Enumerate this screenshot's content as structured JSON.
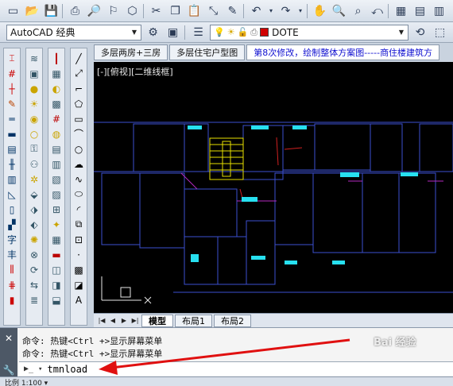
{
  "toolbar1": {
    "icons": [
      "new-file-icon",
      "open-folder-icon",
      "save-icon",
      "print-icon",
      "preview-icon",
      "publish-icon",
      "3d-icon",
      "cut-icon",
      "copy-icon",
      "paste-icon",
      "match-icon",
      "brush-icon",
      "undo-icon",
      "redo-icon",
      "pan-icon",
      "zoom-icon",
      "zoom-window-icon",
      "zoom-previous-icon",
      "properties-icon",
      "design-center-icon",
      "tool-palette-icon",
      "sheet-icon",
      "markup-icon",
      "calc-icon"
    ]
  },
  "toolbar2": {
    "workspace": "AutoCAD 经典",
    "layer_name": "DOTE",
    "layer_color": "#d00000"
  },
  "doc_tabs": [
    {
      "label": "多层两房+三房"
    },
    {
      "label": "多层住宅户型图"
    },
    {
      "label": "第8次修改，绘制整体方案图-----商住楼建筑方"
    }
  ],
  "view_label": "[-][俯视][二维线框]",
  "layout_tabs": {
    "model": "模型",
    "layout1": "布局1",
    "layout2": "布局2"
  },
  "command": {
    "history": [
      "命令: 热键<Ctrl +>显示屏幕菜单",
      "命令: 热键<Ctrl +>显示屏幕菜单"
    ],
    "input_value": "tmnload"
  },
  "status": {
    "text": "比例 1:100 ▾"
  },
  "watermark": "Bai 经验"
}
